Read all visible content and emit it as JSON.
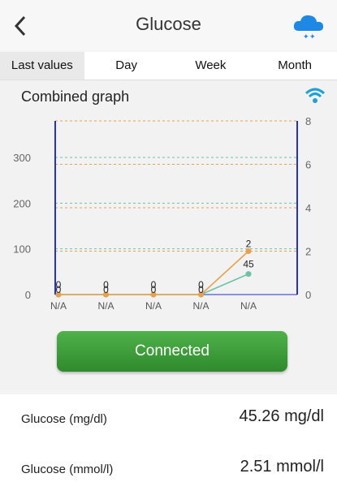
{
  "header": {
    "title": "Glucose",
    "back_icon": "chevron-left-icon",
    "action_icon": "cloud-sync-icon"
  },
  "tabs": [
    "Last values",
    "Day",
    "Week",
    "Month"
  ],
  "graph": {
    "title": "Combined graph",
    "status_icon": "wifi-icon"
  },
  "colors": {
    "mgdl": "#6cc3a5",
    "mmol": "#e8a04a",
    "left_axis": "#2233cc",
    "button": "#3a9a35"
  },
  "chart_data": {
    "type": "line",
    "categories": [
      "N/A",
      "N/A",
      "N/A",
      "N/A",
      "N/A"
    ],
    "series": [
      {
        "values": [
          0,
          0,
          0,
          0,
          45
        ],
        "point_labels": [
          "0",
          "0",
          "0",
          "0",
          "45"
        ],
        "axis": "left"
      },
      {
        "values": [
          0,
          0,
          0,
          0,
          2
        ],
        "point_labels": [
          "0",
          "0",
          "0",
          "0",
          "2"
        ],
        "axis": "right"
      }
    ],
    "left_axis": {
      "ylim": [
        0,
        380
      ],
      "ticks": [
        0,
        100,
        200,
        300
      ]
    },
    "right_axis": {
      "ylim": [
        0,
        8
      ],
      "ticks": [
        0,
        2,
        4,
        6,
        8
      ]
    },
    "grid": true
  },
  "button": {
    "label": "Connected"
  },
  "readings": [
    {
      "label": "Glucose (mg/dl)",
      "value": "45.26 mg/dl"
    },
    {
      "label": "Glucose (mmol/l)",
      "value": "2.51 mmol/l"
    }
  ]
}
